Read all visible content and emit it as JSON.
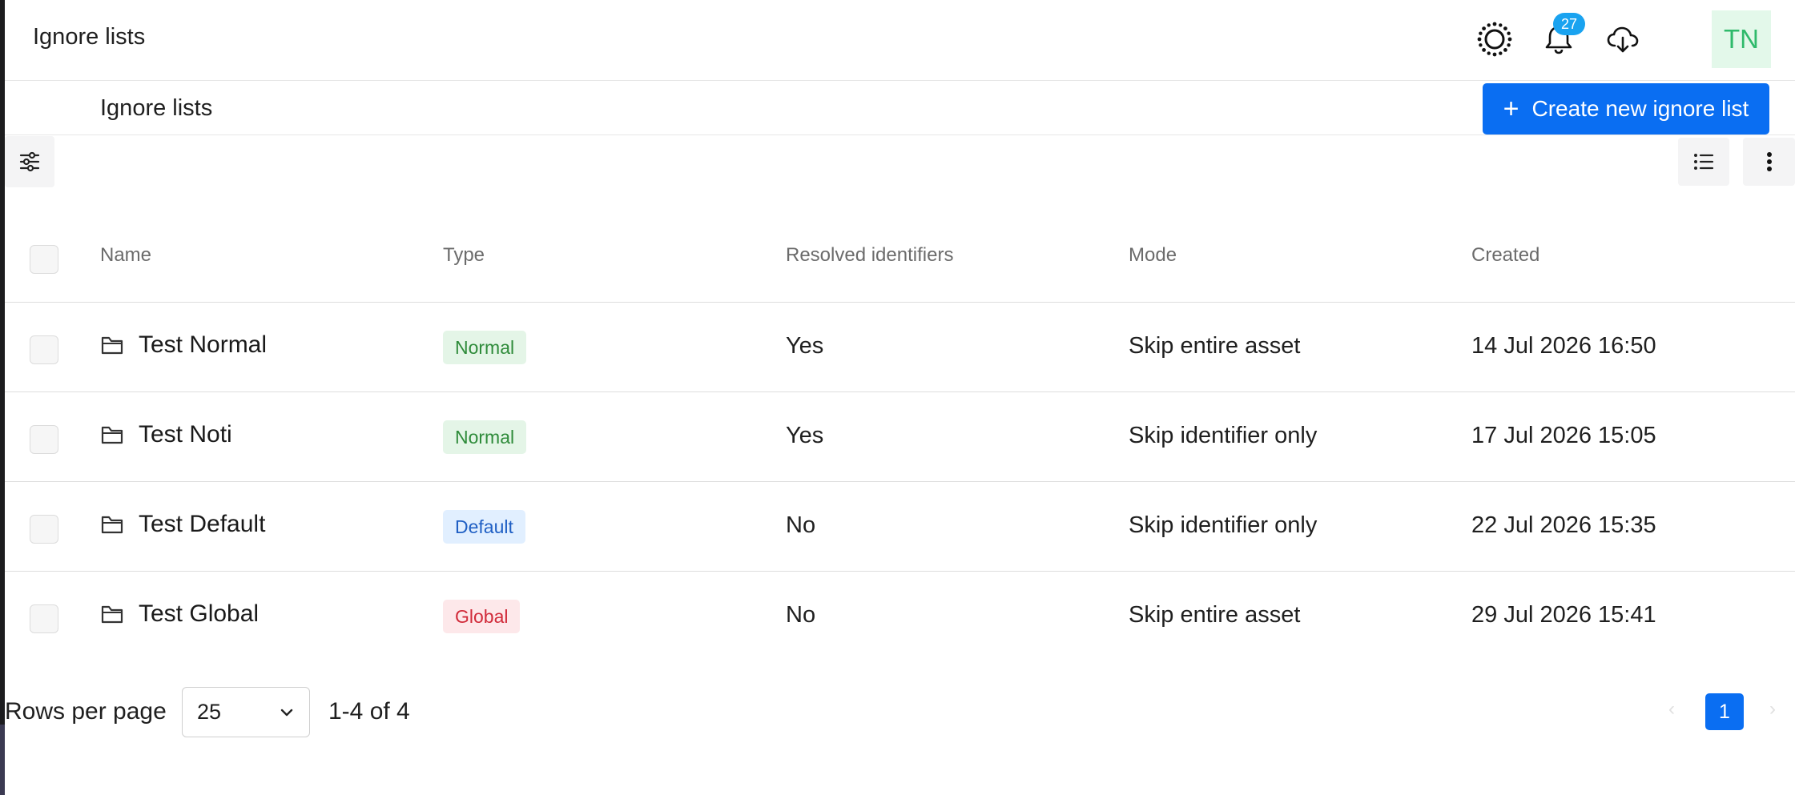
{
  "header": {
    "title": "Ignore lists",
    "notifications_count": "27",
    "avatar_initials": "TN",
    "icons": [
      "theme-sun-icon",
      "bell-icon",
      "cloud-download-icon"
    ]
  },
  "subheader": {
    "breadcrumb": "Ignore lists",
    "create_button_label": "Create new ignore list",
    "create_button_icon": "+"
  },
  "toolbar": {
    "icons": [
      "filter-sliders-icon",
      "list-view-icon",
      "more-vertical-icon"
    ]
  },
  "table": {
    "columns": [
      "Name",
      "Type",
      "Resolved identifiers",
      "Mode",
      "Created"
    ],
    "rows": [
      {
        "name": "Test Normal",
        "type": "Normal",
        "type_style": "normal",
        "resolved": "Yes",
        "mode": "Skip entire asset",
        "created": "14 Jul 2026 16:50"
      },
      {
        "name": "Test Noti",
        "type": "Normal",
        "type_style": "normal",
        "resolved": "Yes",
        "mode": "Skip identifier only",
        "created": "17 Jul 2026 15:05"
      },
      {
        "name": "Test Default",
        "type": "Default",
        "type_style": "default",
        "resolved": "No",
        "mode": "Skip identifier only",
        "created": "22 Jul 2026 15:35"
      },
      {
        "name": "Test Global",
        "type": "Global",
        "type_style": "global",
        "resolved": "No",
        "mode": "Skip entire asset",
        "created": "29 Jul 2026 15:41"
      }
    ]
  },
  "pagination": {
    "rows_per_page_label": "Rows per page",
    "rows_per_page_value": "25",
    "range_text": "1-4 of 4",
    "current_page": "1",
    "prev_symbol": "‹",
    "next_symbol": "›"
  },
  "colors": {
    "primary": "#0a6ef2",
    "badge": "#1aa3f0",
    "avatar_bg": "#e3f8ea",
    "avatar_text": "#2fba6b"
  }
}
